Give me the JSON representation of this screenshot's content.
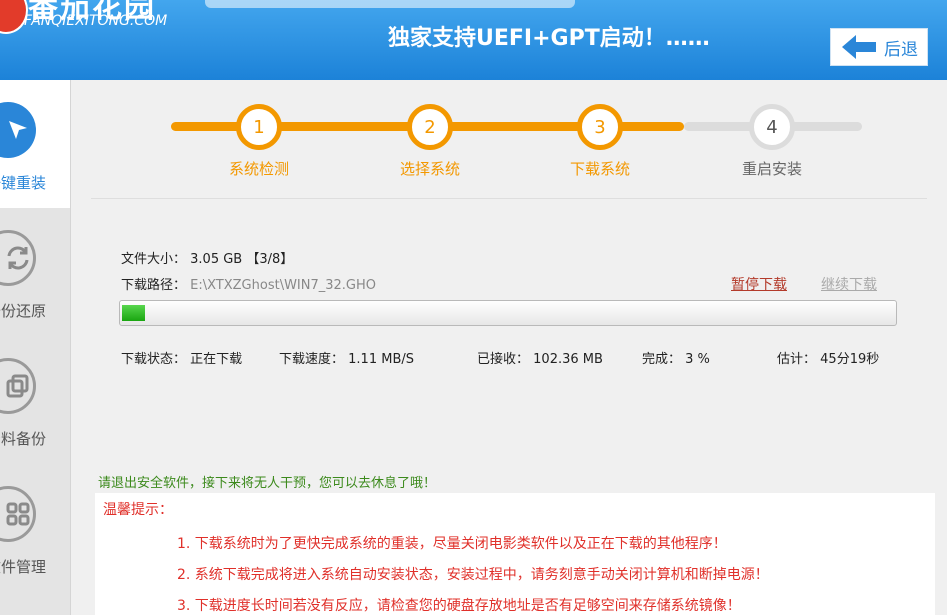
{
  "header": {
    "logo_title": "番茄花园",
    "logo_subtitle": "FANQIEXITONG.COM",
    "slogan": "独家支持UEFI+GPT启动！……",
    "back_label": "后退",
    "accent_color": "#2a86d8"
  },
  "sidebar": {
    "items": [
      {
        "label": "一键重装",
        "icon": "cursor-arrow-icon",
        "active": true
      },
      {
        "label": "备份还原",
        "icon": "refresh-icon",
        "active": false
      },
      {
        "label": "资料备份",
        "icon": "copy-icon",
        "active": false
      },
      {
        "label": "软件管理",
        "icon": "grid-icon",
        "active": false
      }
    ]
  },
  "steps": {
    "items": [
      {
        "number": "1",
        "label": "系统检测",
        "done": true
      },
      {
        "number": "2",
        "label": "选择系统",
        "done": true
      },
      {
        "number": "3",
        "label": "下载系统",
        "done": true
      },
      {
        "number": "4",
        "label": "重启安装",
        "done": false
      }
    ],
    "done_color": "#f39800",
    "todo_color": "#dcdcdc"
  },
  "download": {
    "file_size_label": "文件大小：",
    "file_size_value": "3.05 GB 【3/8】",
    "path_label": "下载路径：",
    "path_value": "E:\\XTXZGhost\\WIN7_32.GHO",
    "pause_label": "暂停下载",
    "resume_label": "继续下载",
    "progress_fraction": 0.03,
    "status_label": "下载状态：",
    "status_value": "正在下载",
    "speed_label": "下载速度：",
    "speed_value": "1.11 MB/S",
    "received_label": "已接收：",
    "received_value": "102.36 MB",
    "complete_label": "完成：",
    "complete_value": "3 %",
    "estimate_label": "估计：",
    "estimate_value": "45分19秒"
  },
  "notice": "请退出安全软件，接下来将无人干预，您可以去休息了哦！",
  "tips": {
    "title": "温馨提示：",
    "items": [
      "1. 下载系统时为了更快完成系统的重装，尽量关闭电影类软件以及正在下载的其他程序！",
      "2. 系统下载完成将进入系统自动安装状态，安装过程中，请务刻意手动关闭计算机和断掉电源！",
      "3. 下载进度长时间若没有反应，请检查您的硬盘存放地址是否有足够空间来存储系统镜像！"
    ]
  }
}
